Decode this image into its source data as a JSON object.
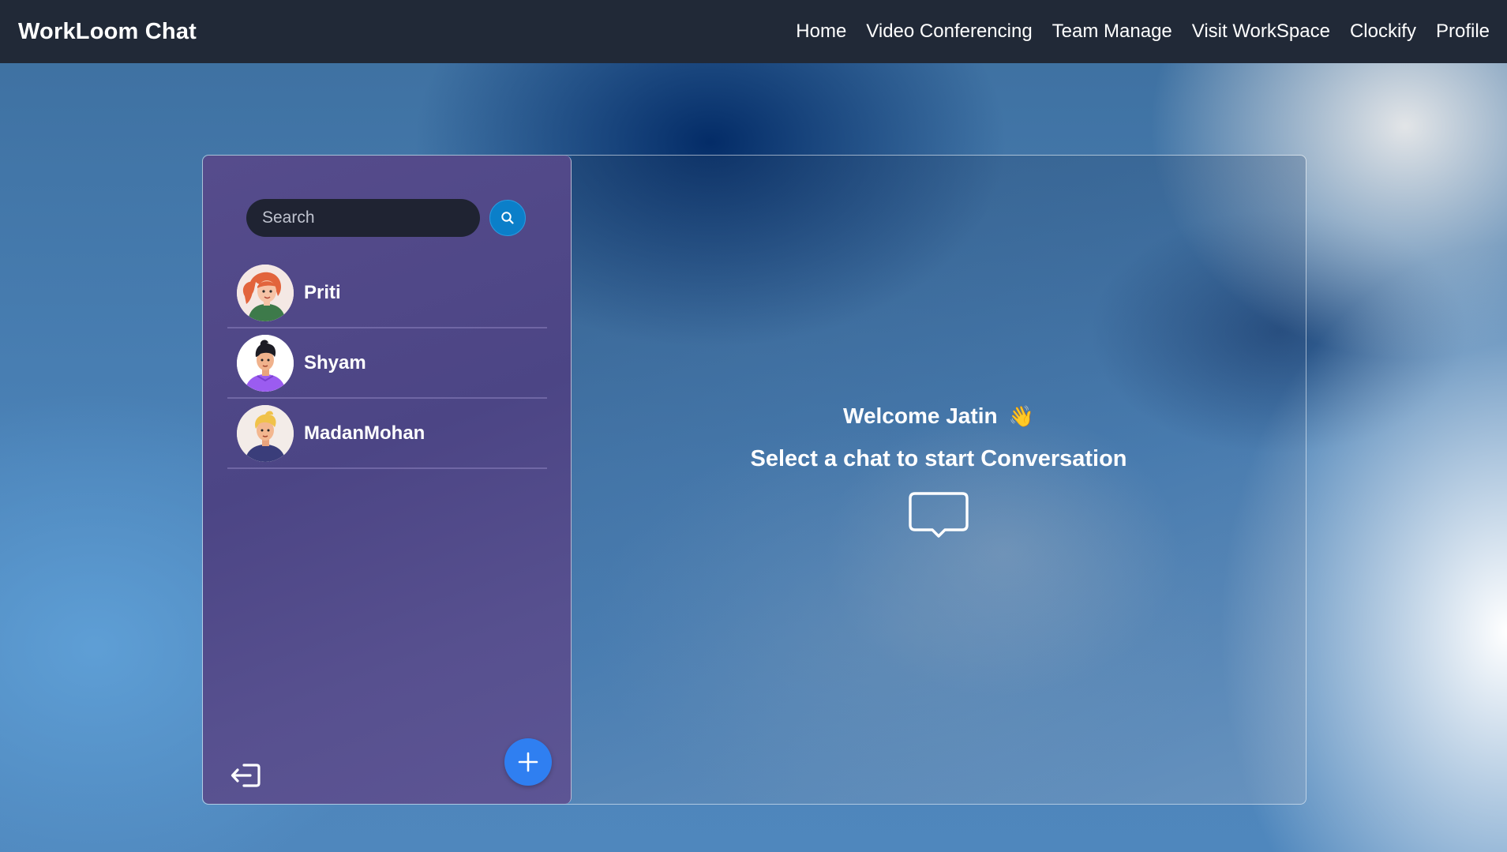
{
  "navbar": {
    "brand": "WorkLoom Chat",
    "links": [
      "Home",
      "Video Conferencing",
      "Team Manage",
      "Visit WorkSpace",
      "Clockify",
      "Profile"
    ]
  },
  "sidebar": {
    "search": {
      "placeholder": "Search",
      "value": ""
    },
    "contacts": [
      {
        "name": "Priti",
        "avatar": "avatar-woman-red-hair"
      },
      {
        "name": "Shyam",
        "avatar": "avatar-man-black-hair"
      },
      {
        "name": "MadanMohan",
        "avatar": "avatar-man-blond-hair"
      }
    ],
    "logout_icon": "logout-icon",
    "add_icon": "plus-icon"
  },
  "main": {
    "welcome": "Welcome Jatin",
    "wave_emoji": "👋",
    "subtitle": "Select a chat to start Conversation",
    "icon": "chat-bubble-icon"
  },
  "colors": {
    "navbar_bg": "#212937",
    "sidebar_bg": "#4c4585",
    "search_button": "#0b7fc9",
    "add_button": "#2f7ff1"
  }
}
